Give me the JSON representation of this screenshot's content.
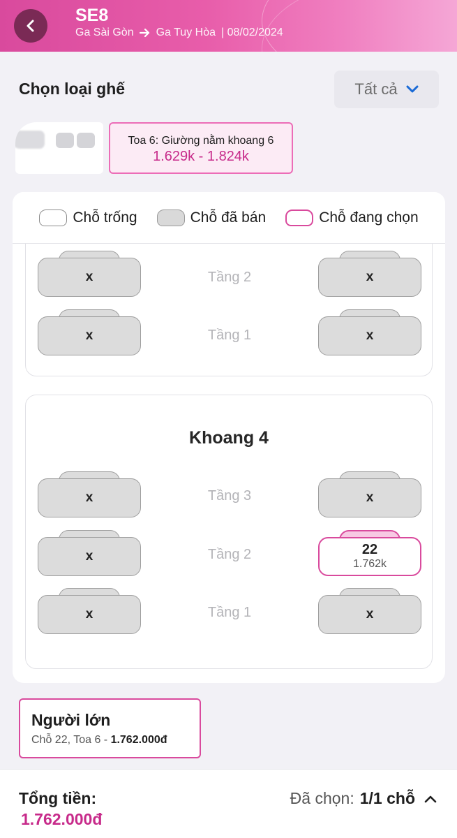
{
  "header": {
    "train_code": "SE8",
    "from_station": "Ga Sài Gòn",
    "to_station": "Ga Tuy Hòa",
    "date_text": "| 08/02/2024"
  },
  "seat_type": {
    "title": "Chọn loại ghế",
    "filter_value": "Tất cả"
  },
  "car": {
    "name": "Toa 6: Giường nằm khoang 6",
    "price_range": "1.629k - 1.824k"
  },
  "legend": {
    "empty": "Chỗ trống",
    "sold": "Chỗ đã bán",
    "selected": "Chỗ đang chọn"
  },
  "compartment_prev": {
    "decks": [
      {
        "label": "Tầng 2",
        "left": {
          "status": "sold",
          "mark": "x"
        },
        "right": {
          "status": "sold",
          "mark": "x"
        }
      },
      {
        "label": "Tầng 1",
        "left": {
          "status": "sold",
          "mark": "x"
        },
        "right": {
          "status": "sold",
          "mark": "x"
        }
      }
    ]
  },
  "compartment_4": {
    "title": "Khoang 4",
    "decks": [
      {
        "label": "Tầng 3",
        "left": {
          "status": "sold",
          "mark": "x"
        },
        "right": {
          "status": "sold",
          "mark": "x"
        }
      },
      {
        "label": "Tầng 2",
        "left": {
          "status": "sold",
          "mark": "x"
        },
        "right": {
          "status": "selected",
          "number": "22",
          "price": "1.762k"
        }
      },
      {
        "label": "Tầng 1",
        "left": {
          "status": "sold",
          "mark": "x"
        },
        "right": {
          "status": "sold",
          "mark": "x"
        }
      }
    ]
  },
  "passenger": {
    "type": "Người lớn",
    "detail": "Chỗ 22, Toa 6 - ",
    "price": "1.762.000đ"
  },
  "footer": {
    "total_label": "Tổng tiền:",
    "total_value": "1.762.000đ",
    "selected_label": "Đã chọn:",
    "selected_count": "1/1 chỗ"
  },
  "colors": {
    "brand": "#d94a9d",
    "price": "#c72a8a"
  }
}
